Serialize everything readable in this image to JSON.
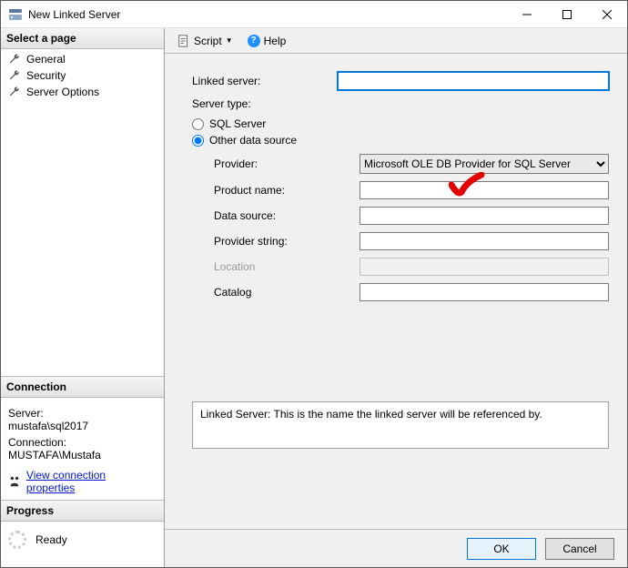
{
  "window": {
    "title": "New Linked Server"
  },
  "sidebar": {
    "selectPageHeader": "Select a page",
    "items": [
      {
        "label": "General"
      },
      {
        "label": "Security"
      },
      {
        "label": "Server Options"
      }
    ],
    "connection": {
      "header": "Connection",
      "serverLabel": "Server:",
      "serverValue": "mustafa\\sql2017",
      "connLabel": "Connection:",
      "connValue": "MUSTAFA\\Mustafa",
      "viewLink": "View connection properties"
    },
    "progress": {
      "header": "Progress",
      "status": "Ready"
    }
  },
  "toolbar": {
    "scriptLabel": "Script",
    "helpLabel": "Help"
  },
  "form": {
    "linkedServerLabel": "Linked server:",
    "linkedServerValue": "",
    "serverTypeLabel": "Server type:",
    "radioSql": "SQL Server",
    "radioOther": "Other data source",
    "providerLabel": "Provider:",
    "providerValue": "Microsoft OLE DB Provider for SQL Server",
    "productLabel": "Product name:",
    "productValue": "",
    "dataSourceLabel": "Data source:",
    "dataSourceValue": "",
    "providerStringLabel": "Provider string:",
    "providerStringValue": "",
    "locationLabel": "Location",
    "locationValue": "",
    "catalogLabel": "Catalog",
    "catalogValue": "",
    "hint": "Linked Server: This is the name the linked server will be referenced by."
  },
  "footer": {
    "ok": "OK",
    "cancel": "Cancel"
  }
}
